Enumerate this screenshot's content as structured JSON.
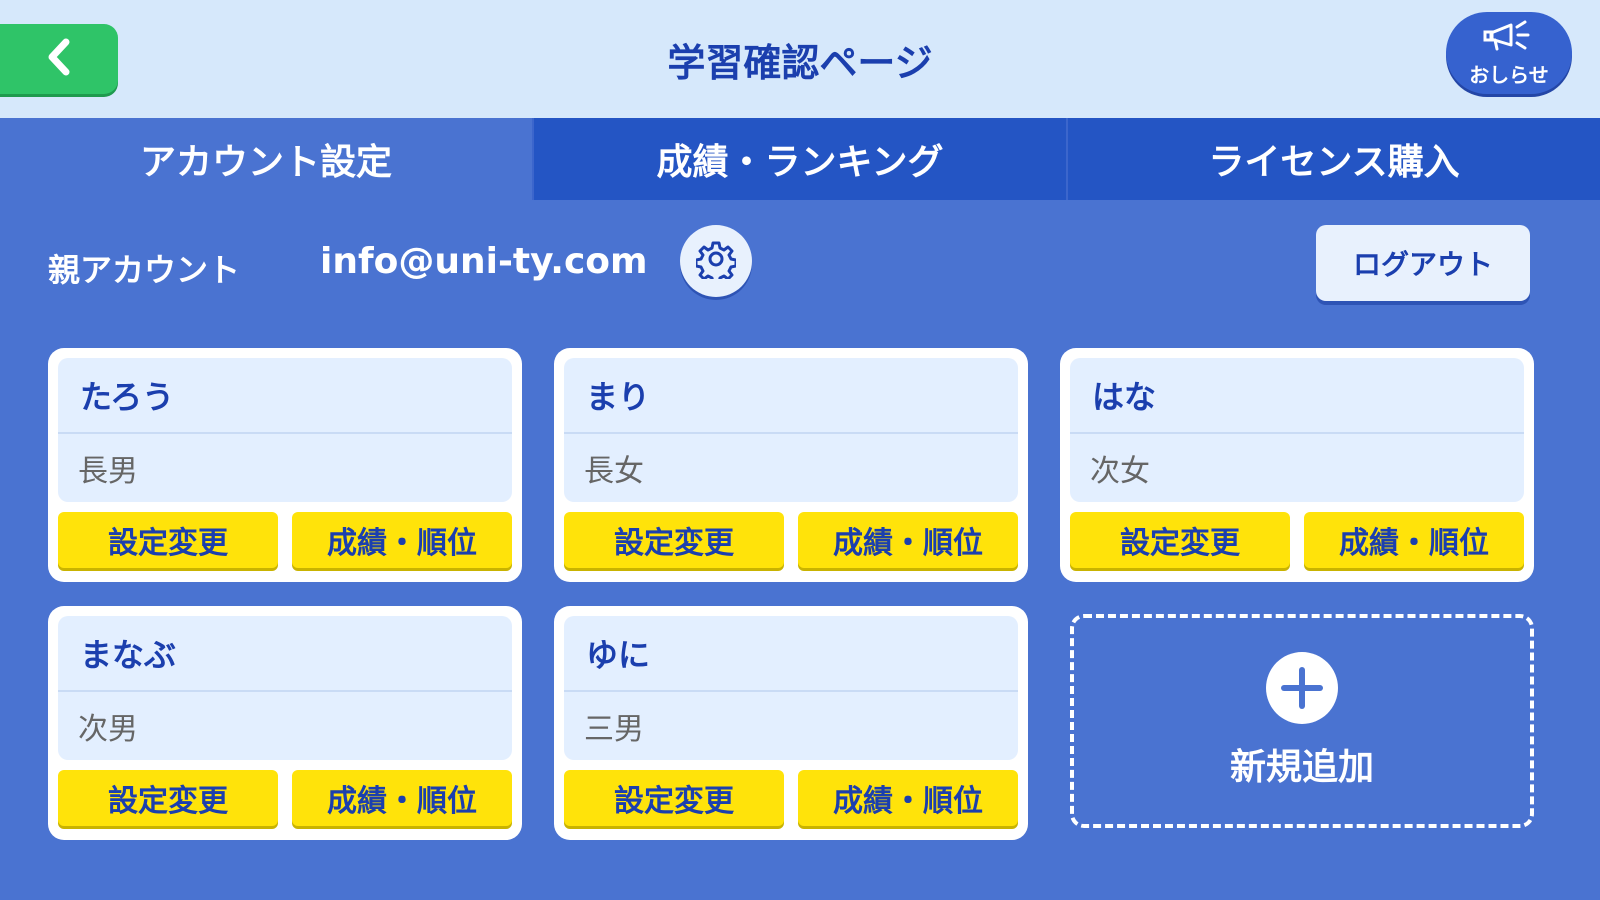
{
  "header": {
    "title": "学習確認ページ",
    "back_icon": "chevron-left-icon",
    "notice_label": "おしらせ",
    "notice_icon": "megaphone-icon"
  },
  "tabs": [
    {
      "label": "アカウント設定",
      "active": true
    },
    {
      "label": "成績・ランキング",
      "active": false
    },
    {
      "label": "ライセンス購入",
      "active": false
    }
  ],
  "account": {
    "label": "親アカウント",
    "email": "info@uni-ty.com",
    "settings_icon": "gear-icon",
    "logout_label": "ログアウト"
  },
  "children": [
    {
      "name": "たろう",
      "relation": "長男",
      "settings_label": "設定変更",
      "results_label": "成績・順位"
    },
    {
      "name": "まり",
      "relation": "長女",
      "settings_label": "設定変更",
      "results_label": "成績・順位"
    },
    {
      "name": "はな",
      "relation": "次女",
      "settings_label": "設定変更",
      "results_label": "成績・順位"
    },
    {
      "name": "まなぶ",
      "relation": "次男",
      "settings_label": "設定変更",
      "results_label": "成績・順位"
    },
    {
      "name": "ゆに",
      "relation": "三男",
      "settings_label": "設定変更",
      "results_label": "成績・順位"
    }
  ],
  "add_new": {
    "label": "新規追加",
    "icon": "plus-icon"
  },
  "colors": {
    "background": "#4a73d1",
    "header": "#d6e8fb",
    "back_button": "#2fc468",
    "action_button": "#ffe30a",
    "text_primary": "#1b3fae"
  }
}
